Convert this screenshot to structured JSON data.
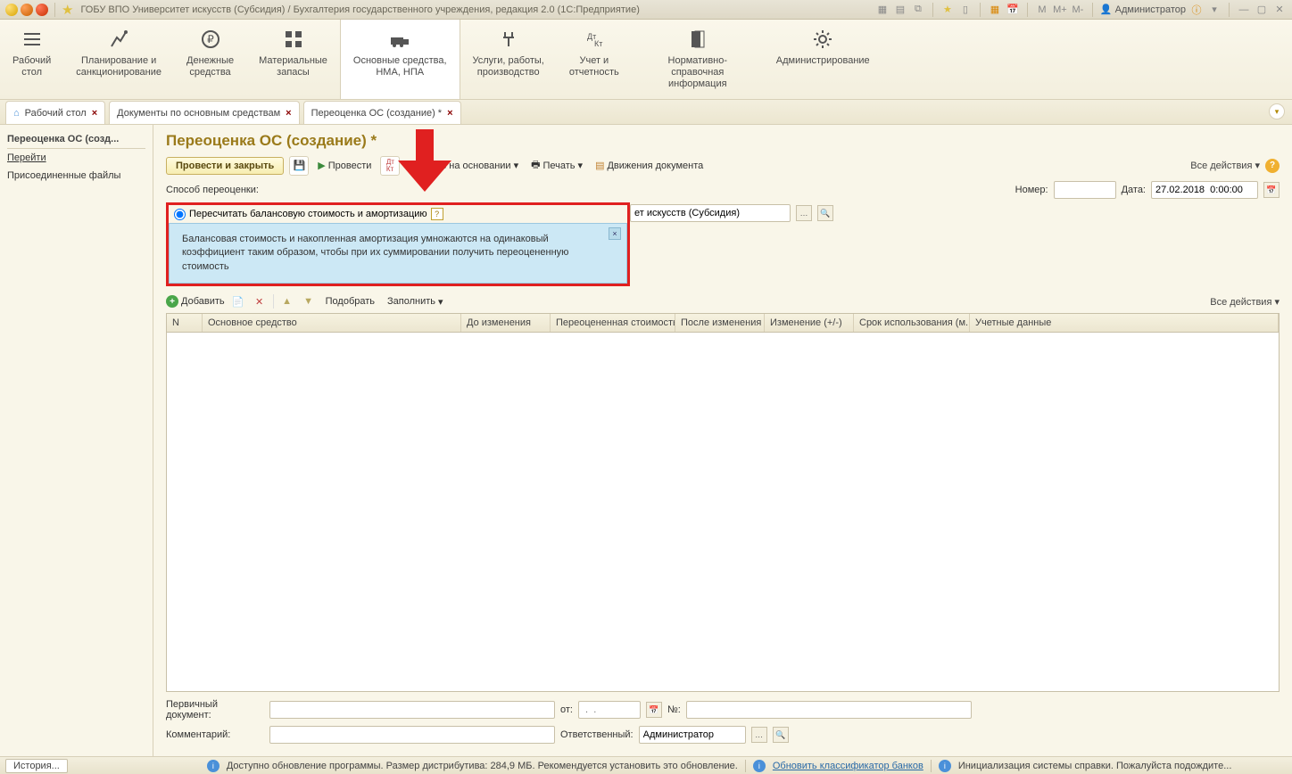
{
  "titlebar": {
    "title": "ГОБУ ВПО Университет искусств (Субсидия) / Бухгалтерия государственного учреждения, редакция 2.0  (1С:Предприятие)",
    "user": "Администратор",
    "m": "M",
    "mplus": "M+",
    "mminus": "M-"
  },
  "sections": [
    {
      "id": "desktop",
      "label": "Рабочий\nстол"
    },
    {
      "id": "planning",
      "label": "Планирование и\nсанкционирование"
    },
    {
      "id": "money",
      "label": "Денежные\nсредства"
    },
    {
      "id": "materials",
      "label": "Материальные\nзапасы"
    },
    {
      "id": "os",
      "label": "Основные средства,\nНМА, НПА"
    },
    {
      "id": "services",
      "label": "Услуги, работы,\nпроизводство"
    },
    {
      "id": "account",
      "label": "Учет и\nотчетность"
    },
    {
      "id": "ref",
      "label": "Нормативно-справочная\nинформация"
    },
    {
      "id": "admin",
      "label": "Администрирование"
    }
  ],
  "tabs": [
    {
      "id": "desktop",
      "label": "Рабочий стол",
      "closable": true,
      "home": true
    },
    {
      "id": "docs",
      "label": "Документы по основным средствам",
      "closable": true
    },
    {
      "id": "current",
      "label": "Переоценка ОС (создание) *",
      "closable": true
    }
  ],
  "sidepanel": {
    "title": "Переоценка ОС (созд...",
    "links": [
      "Перейти",
      "Присоединенные файлы"
    ]
  },
  "page": {
    "title": "Переоценка ОС (создание) *",
    "cmd": {
      "post_close": "Провести и закрыть",
      "post": "Провести",
      "create_based": "Создать на основании",
      "print": "Печать",
      "movements": "Движения документа",
      "all_actions": "Все действия"
    },
    "form": {
      "method_label": "Способ переоценки:",
      "radio1": "Пересчитать балансовую стоимость и амортизацию",
      "number_label": "Номер:",
      "date_label": "Дата:",
      "date_value": "27.02.2018  0:00:00",
      "org_suffix": "ет искусств (Субсидия)",
      "tooltip": "Балансовая стоимость и накопленная амортизация умножаются на одинаковый коэффициент таким образом, чтобы при их суммировании получить переоцененную стоимость"
    },
    "toolbar2": {
      "add": "Добавить",
      "select": "Подобрать",
      "fill": "Заполнить",
      "all_actions": "Все действия"
    },
    "grid_columns": [
      "N",
      "Основное средство",
      "",
      "До изменения",
      "Переоцененная стоимость",
      "После изменения",
      "Изменение (+/-)",
      "Срок использования (м...",
      "Учетные данные"
    ],
    "bottom": {
      "primary_doc": "Первичный документ:",
      "from": "от:",
      "from_placeholder": " .  .    ",
      "num": "№:",
      "comment": "Комментарий:",
      "responsible": "Ответственный:",
      "responsible_value": "Администратор"
    }
  },
  "statusbar": {
    "history": "История...",
    "update_msg": "Доступно обновление программы. Размер дистрибутива: 284,9 МБ. Рекомендуется установить это обновление.",
    "bank_link": "Обновить классификатор банков",
    "help_init": "Инициализация системы справки. Пожалуйста подождите..."
  }
}
